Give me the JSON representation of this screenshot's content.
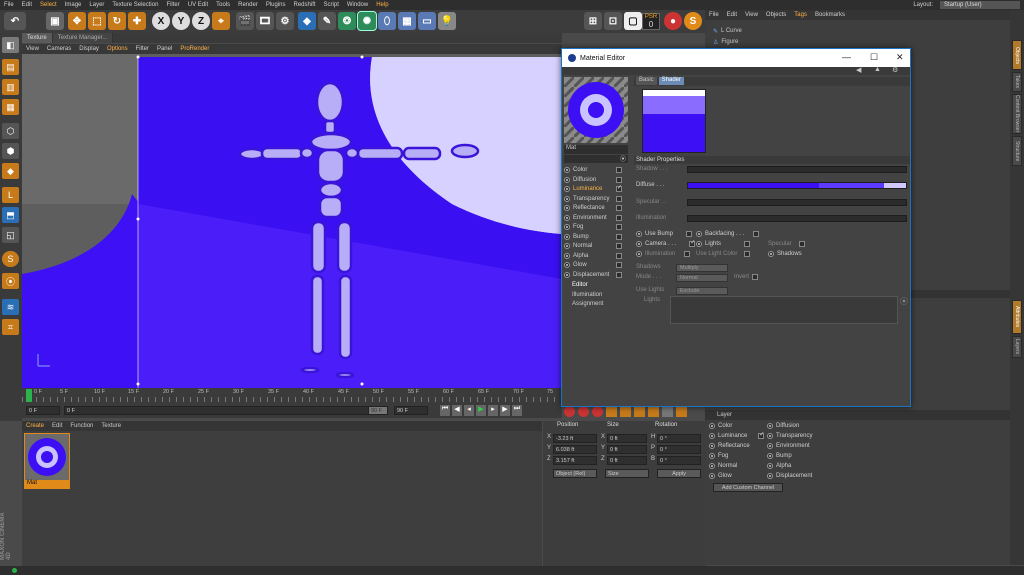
{
  "menubar": {
    "items": [
      "File",
      "Edit",
      "Select",
      "Image",
      "Layer",
      "Texture Selection",
      "Filter",
      "UV Edit",
      "Tools",
      "Render",
      "Plugins",
      "Redshift",
      "Script",
      "Window",
      "Help"
    ],
    "layout_label": "Layout:",
    "layout_value": "Startup (User)"
  },
  "toolbar": {
    "psr_label": "PSR",
    "psr_value": "0",
    "axis_x": "X",
    "axis_y": "Y",
    "axis_z": "Z"
  },
  "viewport": {
    "tabs": [
      "Texture",
      "Texture Manager..."
    ],
    "menu": [
      "View",
      "Cameras",
      "Display",
      "Options",
      "Filter",
      "Panel",
      "ProRender"
    ],
    "colors": {
      "accent": "#3d0ff5",
      "sky": "#c9c3ff",
      "mid": "#5020ff",
      "figure": "#b7aef7"
    }
  },
  "timeline": {
    "ticks": [
      "0 F",
      "5 F",
      "10 F",
      "15 F",
      "20 F",
      "25 F",
      "30 F",
      "35 F",
      "40 F",
      "45 F",
      "50 F",
      "55 F",
      "60 F",
      "65 F",
      "70 F",
      "75"
    ],
    "current_frame": "0 F",
    "start_field": "0 F",
    "end_field": "90 F",
    "end_field_short": "90 F"
  },
  "material_manager": {
    "menu": [
      "Create",
      "Edit",
      "Function",
      "Texture"
    ],
    "material_name": "Mat"
  },
  "coordinates": {
    "headers": [
      "Position",
      "Size",
      "Rotation"
    ],
    "rows": [
      {
        "axis": "X",
        "pos": "-3.23 ft",
        "s_axis": "X",
        "size": "0 ft",
        "r_axis": "H",
        "rot": "0 °"
      },
      {
        "axis": "Y",
        "pos": "6.038 ft",
        "s_axis": "Y",
        "size": "0 ft",
        "r_axis": "P",
        "rot": "0 °"
      },
      {
        "axis": "Z",
        "pos": "3.157 ft",
        "s_axis": "Z",
        "size": "0 ft",
        "r_axis": "B",
        "rot": "0 °"
      }
    ],
    "mode_dropdown": "Object (Rel)",
    "size_dropdown": "Size",
    "apply_label": "Apply"
  },
  "object_manager": {
    "menu": [
      "File",
      "Edit",
      "View",
      "Objects",
      "Tags",
      "Bookmarks"
    ],
    "objects": [
      "L Curve",
      "Figure"
    ]
  },
  "attributes": {
    "layer_label": "Layer",
    "col1": [
      "Color",
      "Luminance",
      "Reflectance",
      "Fog",
      "Normal",
      "Glow"
    ],
    "col1_checked": [
      false,
      true,
      false,
      false,
      false,
      false
    ],
    "col2": [
      "Diffusion",
      "Transparency",
      "Environment",
      "Bump",
      "Alpha",
      "Displacement"
    ],
    "add_channel_label": "Add Custom Channel"
  },
  "right_strip": [
    "Objects",
    "Takes",
    "Content Browser",
    "Structure",
    "Attributes",
    "Layers"
  ],
  "material_editor": {
    "title": "Material Editor",
    "material_name": "Mat",
    "tabs": [
      "Basic",
      "Shader"
    ],
    "channels": [
      {
        "name": "Color",
        "checked": false
      },
      {
        "name": "Diffusion",
        "checked": false
      },
      {
        "name": "Luminance",
        "checked": true,
        "active": true
      },
      {
        "name": "Transparency",
        "checked": false
      },
      {
        "name": "Reflectance",
        "checked": false
      },
      {
        "name": "Environment",
        "checked": false
      },
      {
        "name": "Fog",
        "checked": false
      },
      {
        "name": "Bump",
        "checked": false
      },
      {
        "name": "Normal",
        "checked": false
      },
      {
        "name": "Alpha",
        "checked": false
      },
      {
        "name": "Glow",
        "checked": false
      },
      {
        "name": "Displacement",
        "checked": false
      }
    ],
    "sub_items": [
      "Editor",
      "Illumination",
      "Assignment"
    ],
    "section_title": "Shader Properties",
    "props": {
      "shadow": "Shadow . . .",
      "diffuse": "Diffuse . . .",
      "specular": "Specular . .",
      "illumination": "Illumination"
    },
    "checkboxes": {
      "use_bump": "Use Bump",
      "backfacing": "Backfacing . . .",
      "camera": "Camera . . .",
      "lights": "Lights",
      "specular": "Specular",
      "illumination": "Illumination",
      "use_light_color": "Use Light Color",
      "shadows": "Shadows"
    },
    "dropdowns": {
      "shadows_label": "Shadows",
      "shadows_value": "Multiply",
      "mode_label": "Mode . . .",
      "mode_value": "Normal",
      "invert_label": "Invert",
      "use_lights_label": "Use Lights",
      "use_lights_value": "Exclude",
      "lights_label": "Lights"
    }
  },
  "brand": "MAXON CINEMA 4D"
}
